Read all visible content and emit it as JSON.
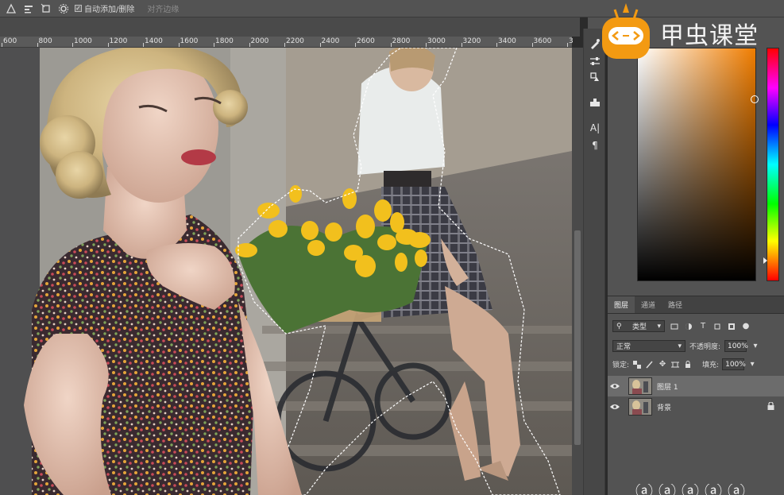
{
  "options_bar": {
    "auto_add_remove_label": "自动添加/删除",
    "align_edges_label": "对齐边缘"
  },
  "ruler": {
    "marks": [
      "600",
      "800",
      "1000",
      "1200",
      "1400",
      "1600",
      "1800",
      "2000",
      "2200",
      "2400",
      "2600",
      "2800",
      "3000",
      "3200",
      "3400",
      "3600",
      "3"
    ]
  },
  "watermark": {
    "brand_text": "甲虫课堂",
    "bottom_text": "ⓐ ⓐ ⓐ ⓐ ⓐ"
  },
  "panels": {
    "color_picker": {
      "base_hue": "#f07d00",
      "cursor_glyph": "C"
    },
    "layers": {
      "tabs": [
        {
          "label": "图层",
          "active": true
        },
        {
          "label": "通道",
          "active": false
        },
        {
          "label": "路径",
          "active": false
        }
      ],
      "filter_kind_label": "类型",
      "blend_mode": "正常",
      "opacity_label": "不透明度:",
      "opacity_value": "100%",
      "lock_label": "锁定:",
      "fill_label": "填充:",
      "fill_value": "100%",
      "items": [
        {
          "name": "图层 1",
          "selected": true,
          "locked": false
        },
        {
          "name": "背景",
          "selected": false,
          "locked": true
        }
      ]
    }
  },
  "tools": {
    "text_tool_glyph": "A|",
    "paragraph_glyph": "¶"
  },
  "colors": {
    "panel_bg": "#535353",
    "brand_orange": "#f39a12",
    "selection_ants": "#ffffff"
  }
}
